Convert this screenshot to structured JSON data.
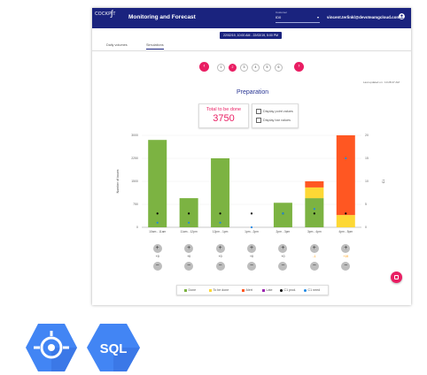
{
  "header": {
    "logo_text": "COCKPIT",
    "title": "Monitoring and Forecast",
    "customer_label": "Customer",
    "customer_value": "ID0",
    "user_email": "vincent.terlinkl@devoteamgcloud.com"
  },
  "date_range": "22/02/19, 10:00 AM - 22/02/19, 5:00 PM",
  "tabs": [
    "Daily volumes",
    "Simulations"
  ],
  "stepper": {
    "prev": "‹",
    "next": "›",
    "steps": [
      "1",
      "2",
      "3",
      "4",
      "5",
      "6"
    ],
    "active_index": 1
  },
  "last_updated": "Last updated on : 10:28:47 AM",
  "section_title": "Preparation",
  "total": {
    "label": "Total to be done",
    "value": "3750"
  },
  "options": [
    "Display point values",
    "Display bar values"
  ],
  "chart_data": {
    "type": "bar",
    "categories": [
      "10am - 11am",
      "11am - 12pm",
      "12pm - 1pm",
      "1pm - 2pm",
      "2pm - 3pm",
      "3pm - 4pm",
      "4pm - 5pm"
    ],
    "series": [
      {
        "name": "Done",
        "color": "#7cb342",
        "values": [
          2850,
          950,
          2250,
          0,
          800,
          950,
          0
        ]
      },
      {
        "name": "To be done",
        "color": "#fdd835",
        "values": [
          0,
          0,
          0,
          0,
          0,
          350,
          400
        ]
      },
      {
        "name": "Alert",
        "color": "#ff5722",
        "values": [
          0,
          0,
          0,
          0,
          0,
          200,
          2600
        ]
      },
      {
        "name": "Late",
        "color": "#9c27b0",
        "values": [
          0,
          0,
          0,
          0,
          0,
          0,
          0
        ]
      }
    ],
    "c1_prod": [
      3,
      3,
      3,
      3,
      3,
      3,
      3
    ],
    "c1_need": [
      1,
      1,
      1,
      0,
      3,
      4,
      15
    ],
    "ylabel": "Number of boxes",
    "y2label": "C1",
    "ylim": [
      0,
      3000
    ],
    "y2lim": [
      0,
      20
    ],
    "yticks": [
      "0",
      "750",
      "1500",
      "2250",
      "3000"
    ],
    "y2ticks": [
      "0",
      "5",
      "10",
      "15",
      "20"
    ]
  },
  "controls": {
    "values": [
      "+0",
      "+0",
      "+0",
      "+0",
      "+0",
      "-1",
      "+19"
    ],
    "value_colors": [
      "#333333",
      "#333333",
      "#333333",
      "#333333",
      "#333333",
      "#ff9800",
      "#ff9800"
    ],
    "plus": "+",
    "minus": "−"
  },
  "legend": [
    "Done",
    "To be done",
    "Alert",
    "Late",
    "C1 prod.",
    "C1 need"
  ],
  "legend_colors": [
    "#7cb342",
    "#fdd835",
    "#ff5722",
    "#9c27b0",
    "#000000",
    "#1e88e5"
  ],
  "product_icons": {
    "first": "cloud-dataprep-icon",
    "second_text": "SQL"
  }
}
